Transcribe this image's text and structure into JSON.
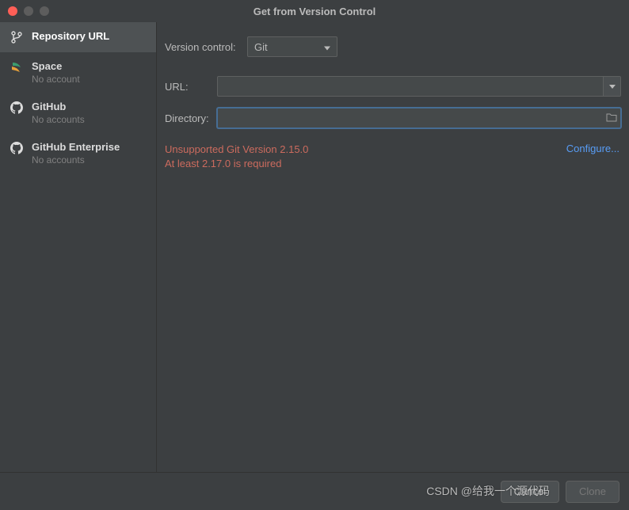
{
  "window": {
    "title": "Get from Version Control"
  },
  "sidebar": {
    "items": [
      {
        "label": "Repository URL",
        "sub": ""
      },
      {
        "label": "Space",
        "sub": "No account"
      },
      {
        "label": "GitHub",
        "sub": "No accounts"
      },
      {
        "label": "GitHub Enterprise",
        "sub": "No accounts"
      }
    ]
  },
  "form": {
    "version_control_label": "Version control:",
    "version_control_value": "Git",
    "url_label": "URL:",
    "url_value": "",
    "directory_label": "Directory:",
    "directory_value": ""
  },
  "error": {
    "line1": "Unsupported Git Version 2.15.0",
    "line2": "At least 2.17.0 is required"
  },
  "configure_link": "Configure...",
  "footer": {
    "cancel": "Cancel",
    "clone": "Clone"
  },
  "watermark": "CSDN @给我一个源代码"
}
